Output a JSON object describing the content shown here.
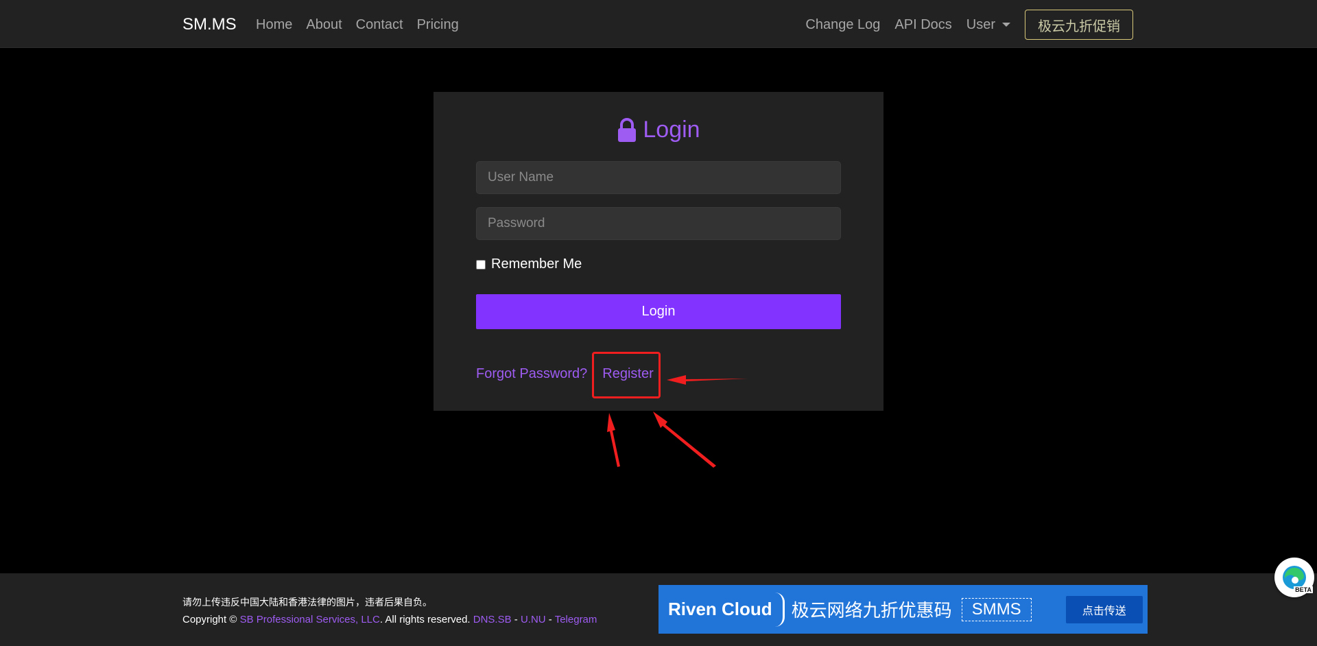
{
  "navbar": {
    "brand": "SM.MS",
    "left_links": [
      "Home",
      "About",
      "Contact",
      "Pricing"
    ],
    "right_links": [
      "Change Log",
      "API Docs"
    ],
    "user_menu": "User",
    "promo_button": "极云九折促销"
  },
  "login": {
    "title": "Login",
    "username_placeholder": "User Name",
    "password_placeholder": "Password",
    "remember_label": "Remember Me",
    "submit_label": "Login",
    "forgot_link": "Forgot Password?",
    "register_link": "Register"
  },
  "annotation": {
    "color": "#f01e1e"
  },
  "footer": {
    "notice": "请勿上传违反中国大陆和香港法律的图片，违者后果自负。",
    "copyright_prefix": "Copyright ©",
    "company": "SB Professional Services, LLC",
    "rights": ". All rights reserved.",
    "links": [
      "DNS.SB",
      "U.NU",
      "Telegram"
    ],
    "separator": "-"
  },
  "banner": {
    "brand": "Riven Cloud",
    "text": "极云网络九折优惠码",
    "code": "SMMS",
    "button": "点击传送"
  },
  "edge_badge": "BETA",
  "colors": {
    "accent": "#8333ff",
    "link": "#9e5cf2",
    "banner": "#2175d9"
  }
}
